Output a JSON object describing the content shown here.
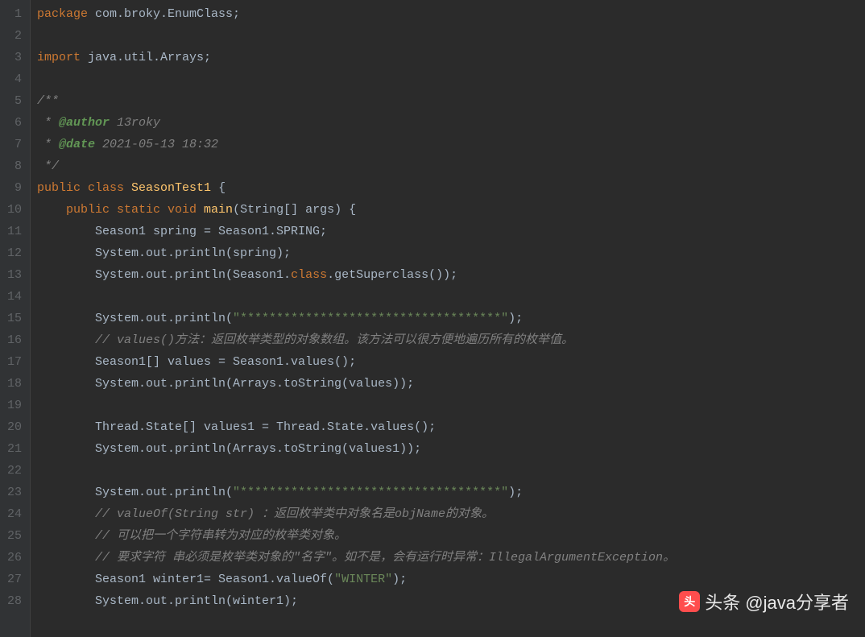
{
  "lines": [
    {
      "num": "1",
      "segments": [
        {
          "cls": "kw",
          "text": "package "
        },
        {
          "cls": "default",
          "text": "com.broky.EnumClass;"
        }
      ]
    },
    {
      "num": "2",
      "segments": []
    },
    {
      "num": "3",
      "segments": [
        {
          "cls": "kw",
          "text": "import "
        },
        {
          "cls": "default",
          "text": "java.util.Arrays;"
        }
      ]
    },
    {
      "num": "4",
      "segments": []
    },
    {
      "num": "5",
      "segments": [
        {
          "cls": "comment",
          "text": "/**"
        }
      ]
    },
    {
      "num": "6",
      "segments": [
        {
          "cls": "comment",
          "text": " * "
        },
        {
          "cls": "doc-tag",
          "text": "@author"
        },
        {
          "cls": "doc-val",
          "text": " 13roky"
        }
      ]
    },
    {
      "num": "7",
      "segments": [
        {
          "cls": "comment",
          "text": " * "
        },
        {
          "cls": "doc-tag",
          "text": "@date"
        },
        {
          "cls": "doc-val",
          "text": " 2021-05-13 18:32"
        }
      ]
    },
    {
      "num": "8",
      "segments": [
        {
          "cls": "comment",
          "text": " */"
        }
      ]
    },
    {
      "num": "9",
      "segments": [
        {
          "cls": "kw",
          "text": "public class "
        },
        {
          "cls": "classname",
          "text": "SeasonTest1"
        },
        {
          "cls": "default",
          "text": " {"
        }
      ]
    },
    {
      "num": "10",
      "segments": [
        {
          "cls": "default",
          "text": "    "
        },
        {
          "cls": "kw",
          "text": "public static void "
        },
        {
          "cls": "method",
          "text": "main"
        },
        {
          "cls": "default",
          "text": "(String[] args) {"
        }
      ]
    },
    {
      "num": "11",
      "segments": [
        {
          "cls": "default",
          "text": "        Season1 spring = Season1.SPRING;"
        }
      ]
    },
    {
      "num": "12",
      "segments": [
        {
          "cls": "default",
          "text": "        System.out.println(spring);"
        }
      ]
    },
    {
      "num": "13",
      "segments": [
        {
          "cls": "default",
          "text": "        System.out.println(Season1."
        },
        {
          "cls": "kw",
          "text": "class"
        },
        {
          "cls": "default",
          "text": ".getSuperclass());"
        }
      ]
    },
    {
      "num": "14",
      "segments": []
    },
    {
      "num": "15",
      "segments": [
        {
          "cls": "default",
          "text": "        System.out.println("
        },
        {
          "cls": "str",
          "text": "\"************************************\""
        },
        {
          "cls": "default",
          "text": ");"
        }
      ]
    },
    {
      "num": "16",
      "segments": [
        {
          "cls": "default",
          "text": "        "
        },
        {
          "cls": "comment",
          "text": "// values()方法：返回枚举类型的对象数组。该方法可以很方便地遍历所有的枚举值。"
        }
      ]
    },
    {
      "num": "17",
      "segments": [
        {
          "cls": "default",
          "text": "        Season1[] values = Season1.values();"
        }
      ]
    },
    {
      "num": "18",
      "segments": [
        {
          "cls": "default",
          "text": "        System.out.println(Arrays.toString(values));"
        }
      ]
    },
    {
      "num": "19",
      "segments": []
    },
    {
      "num": "20",
      "segments": [
        {
          "cls": "default",
          "text": "        Thread.State[] values1 = Thread.State.values();"
        }
      ]
    },
    {
      "num": "21",
      "segments": [
        {
          "cls": "default",
          "text": "        System.out.println(Arrays.toString(values1));"
        }
      ]
    },
    {
      "num": "22",
      "segments": []
    },
    {
      "num": "23",
      "segments": [
        {
          "cls": "default",
          "text": "        System.out.println("
        },
        {
          "cls": "str",
          "text": "\"************************************\""
        },
        {
          "cls": "default",
          "text": ");"
        }
      ]
    },
    {
      "num": "24",
      "segments": [
        {
          "cls": "default",
          "text": "        "
        },
        {
          "cls": "comment",
          "text": "// valueOf(String str) ：返回枚举类中对象名是objName的对象。"
        }
      ]
    },
    {
      "num": "25",
      "segments": [
        {
          "cls": "default",
          "text": "        "
        },
        {
          "cls": "comment",
          "text": "// 可以把一个字符串转为对应的枚举类对象。"
        }
      ]
    },
    {
      "num": "26",
      "segments": [
        {
          "cls": "default",
          "text": "        "
        },
        {
          "cls": "comment",
          "text": "// 要求字符 串必须是枚举类对象的\"名字\"。如不是，会有运行时异常：IllegalArgumentException。"
        }
      ]
    },
    {
      "num": "27",
      "segments": [
        {
          "cls": "default",
          "text": "        Season1 winter1= Season1.valueOf("
        },
        {
          "cls": "str",
          "text": "\"WINTER\""
        },
        {
          "cls": "default",
          "text": ");"
        }
      ]
    },
    {
      "num": "28",
      "segments": [
        {
          "cls": "default",
          "text": "        System.out.println(winter1);"
        }
      ]
    }
  ],
  "watermark": {
    "prefix": "头条",
    "handle": "@java分享者"
  }
}
